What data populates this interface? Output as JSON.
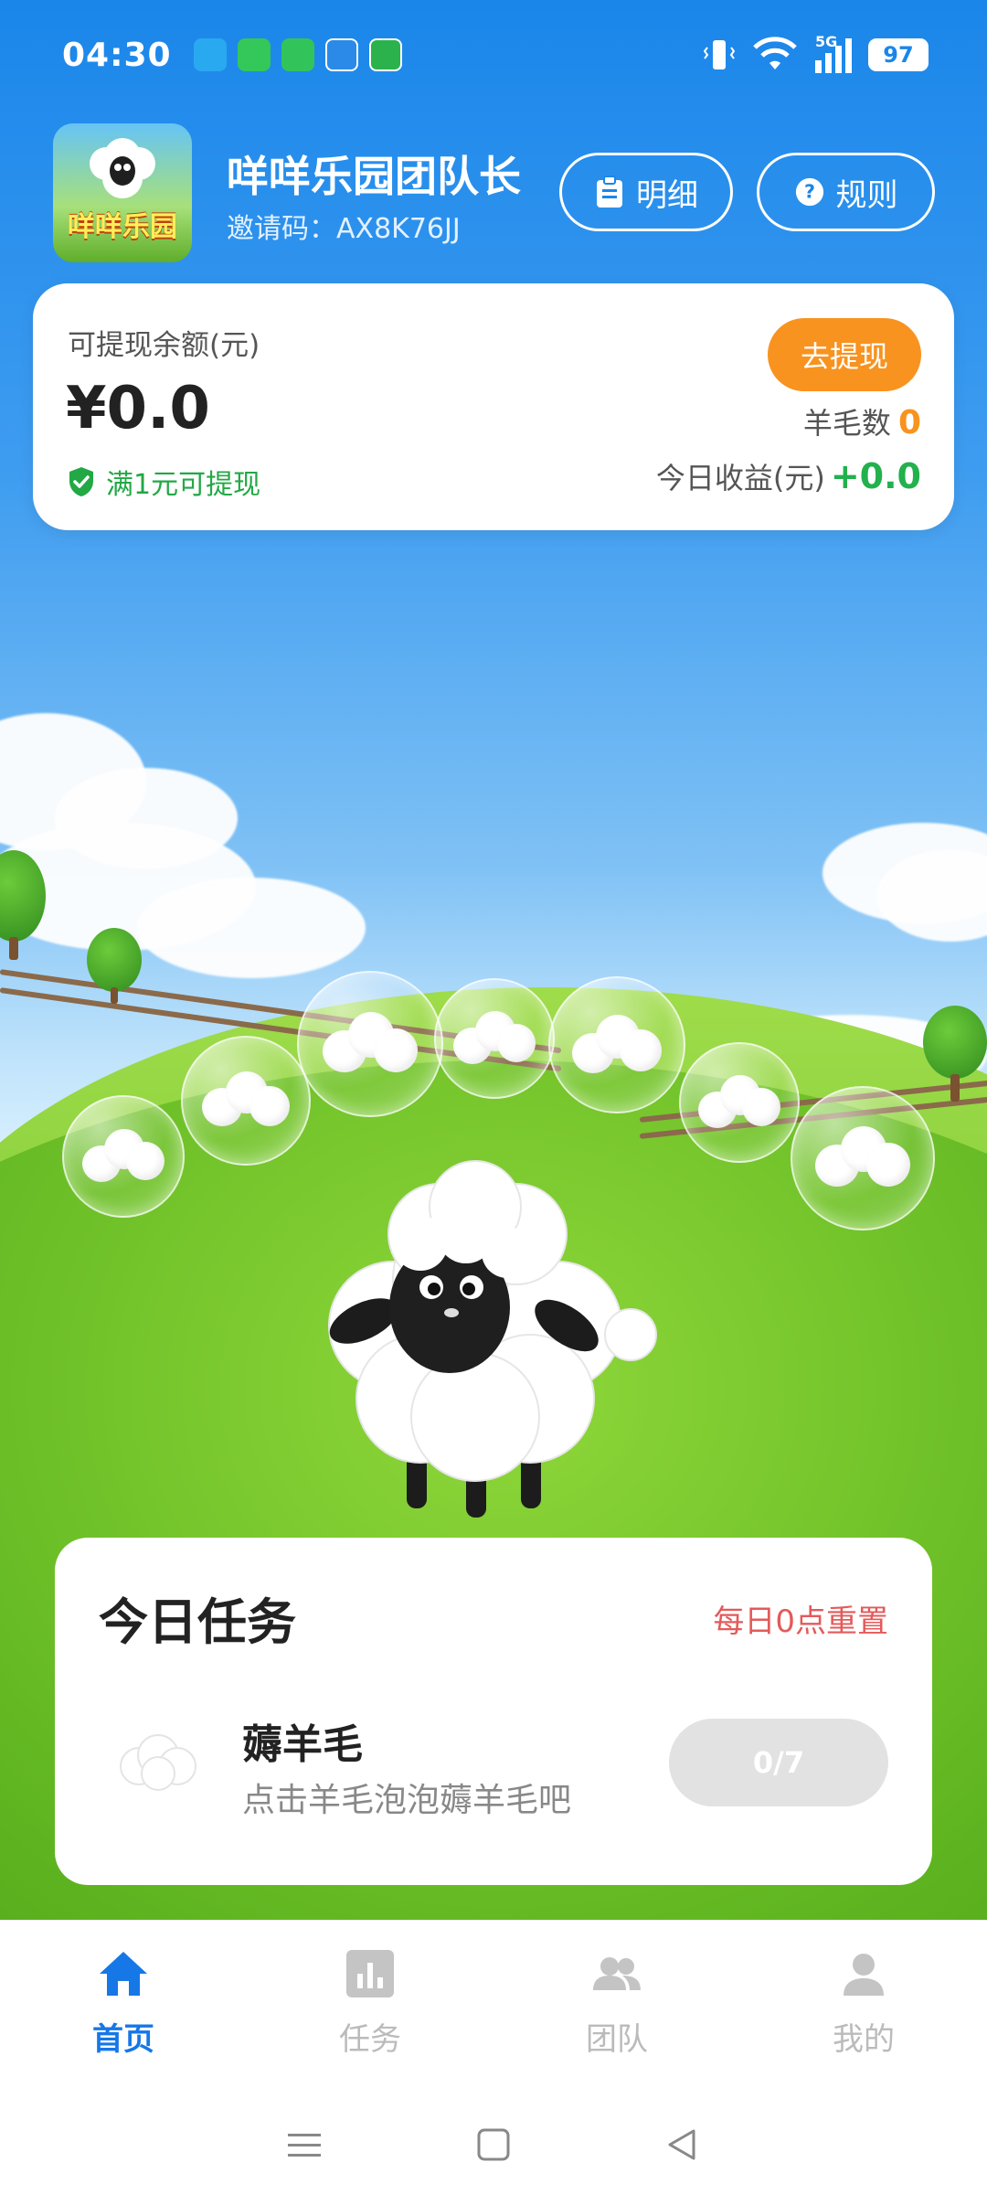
{
  "status_bar": {
    "time": "04:30",
    "network": "5G",
    "battery": "97"
  },
  "header": {
    "app_name": "咩咩乐园团队长",
    "invite_label": "邀请码：",
    "invite_code": "AX8K76JJ",
    "logo_text": "咩咩乐园",
    "detail_label": "明细",
    "rules_label": "规则"
  },
  "balance": {
    "label": "可提现余额(元)",
    "amount": "¥0.0",
    "tip": "满1元可提现",
    "withdraw_label": "去提现",
    "wool_label": "羊毛数",
    "wool_value": "0",
    "today_label": "今日收益(元)",
    "today_value": "+0.0"
  },
  "tasks": {
    "title": "今日任务",
    "reset_note": "每日0点重置",
    "items": [
      {
        "name": "薅羊毛",
        "desc": "点击羊毛泡泡薅羊毛吧",
        "progress": "0/7"
      }
    ]
  },
  "bottom_nav": {
    "items": [
      {
        "label": "首页",
        "icon": "home-icon",
        "active": true
      },
      {
        "label": "任务",
        "icon": "chart-icon",
        "active": false
      },
      {
        "label": "团队",
        "icon": "team-icon",
        "active": false
      },
      {
        "label": "我的",
        "icon": "profile-icon",
        "active": false
      }
    ]
  },
  "colors": {
    "primary": "#1677e6",
    "accent_orange": "#f8931f",
    "success_green": "#22b14c",
    "reset_red": "#e45a5a"
  }
}
